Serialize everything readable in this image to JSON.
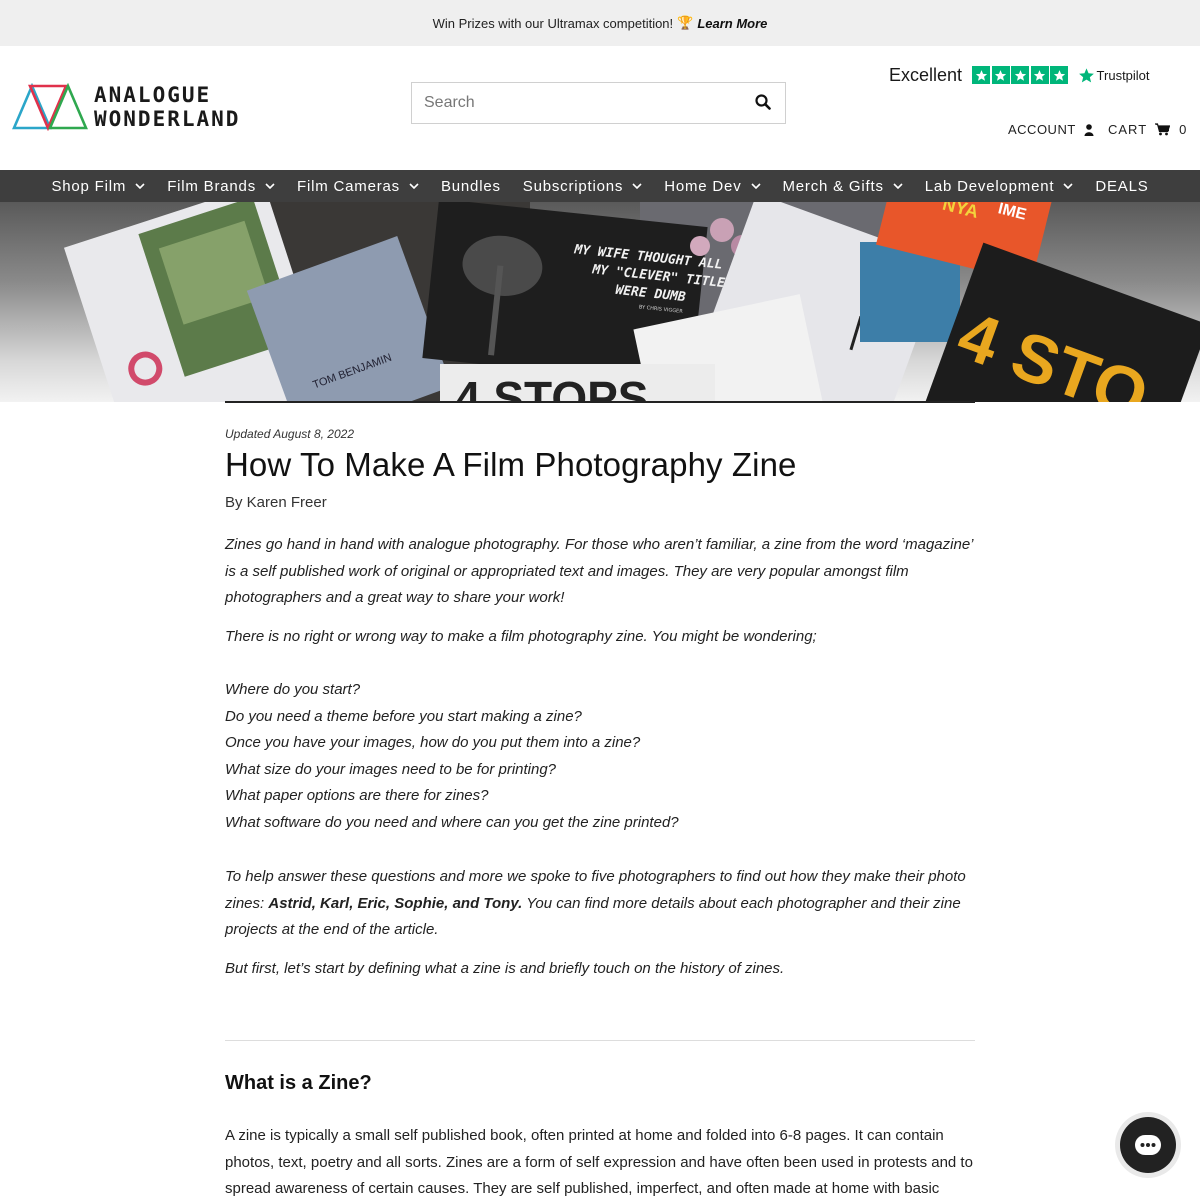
{
  "announcement": {
    "text": "Win Prizes with our Ultramax competition!",
    "trophy": "🏆",
    "link_label": "Learn More"
  },
  "header": {
    "logo_line1": "ANALOGUE",
    "logo_line2": "WONDERLAND",
    "search_placeholder": "Search",
    "trustpilot_rating": "Excellent",
    "trustpilot_label": "Trustpilot",
    "account_label": "ACCOUNT",
    "cart_label": "CART",
    "cart_count": "0"
  },
  "nav": {
    "items": [
      {
        "label": "Shop Film"
      },
      {
        "label": "Film Brands"
      },
      {
        "label": "Film Cameras"
      },
      {
        "label": "Bundles"
      },
      {
        "label": "Subscriptions"
      },
      {
        "label": "Home Dev"
      },
      {
        "label": "Merch & Gifts"
      },
      {
        "label": "Lab Development"
      },
      {
        "label": "DEALS"
      }
    ]
  },
  "hero": {
    "zine_title_1": "MY WIFE THOUGHT ALL",
    "zine_title_2": "MY \"CLEVER\" TITLES",
    "zine_title_3": "WERE DUMB",
    "zine_author": "BY CHRIS VIGGER",
    "side_name": "TOM BENJAMIN",
    "bottom_text": "4 STOPS",
    "right_text": "4 STO",
    "orange_text": "NYA",
    "orange_text2": "IME"
  },
  "article": {
    "updated": "Updated August 8, 2022",
    "title": "How To Make A Film Photography Zine",
    "author": "By Karen Freer",
    "p1": "Zines go hand in hand with analogue photography. For those who aren’t familiar, a zine from the word ‘magazine’ is a self published work of original or appropriated text and images. They are very popular amongst film photographers and a great way to share your work!",
    "p2": "There is no right or wrong way to make a film photography zine. You might be wondering;",
    "questions": [
      "Where do you start?",
      "Do you need a theme before you start making a zine?",
      "Once you have your images, how do you put them into a zine?",
      "What size do your images need to be for printing?",
      "What paper options are there for zines?",
      "What software do you need and where can you get the zine printed?"
    ],
    "p3_start": "To help answer these questions and more we spoke to five photographers to find out how they make their photo zines: ",
    "p3_bold": "Astrid, Karl, Eric, Sophie, and Tony.",
    "p3_end": " You can find more details about each photographer and their zine projects at the end of the article.",
    "p4": "But first, let’s start by defining what a zine is and briefly touch on the history of zines.",
    "h2": "What is a Zine?",
    "p5": "A zine is typically a small self published book, often printed at home and folded into 6-8 pages. It can contain photos, text, poetry and all sorts. Zines are a form of self expression and have often been used in protests and to spread awareness of certain causes. They are self published, imperfect, and often made at home with basic"
  },
  "colors": {
    "trustpilot_green": "#00b67a",
    "nav_bg": "#3e3e3e",
    "announce_bg": "#efefef"
  },
  "icons": {
    "search": "search-icon",
    "account": "user-icon",
    "cart": "cart-icon",
    "chat": "chat-icon"
  }
}
